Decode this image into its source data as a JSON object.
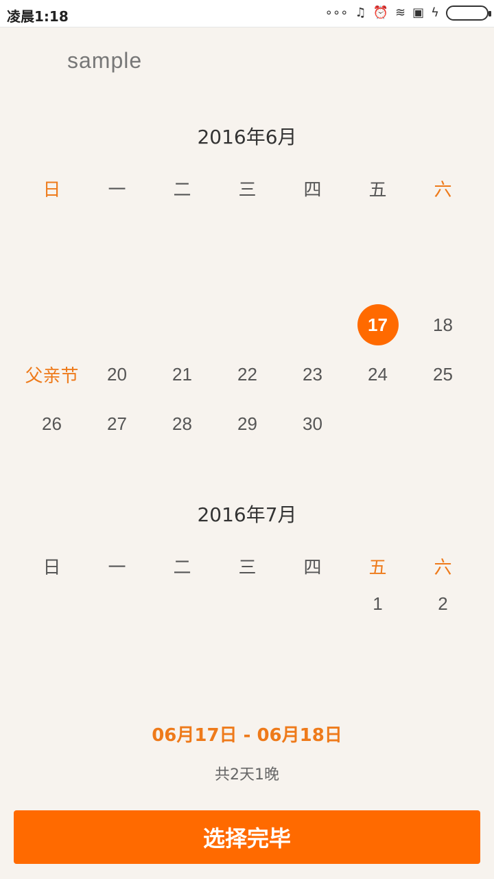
{
  "status": {
    "time": "凌晨1:18",
    "icons": [
      "signal-dots-icon",
      "headphones-icon",
      "alarm-icon",
      "wifi-icon",
      "sim-icon",
      "charging-icon",
      "battery-icon"
    ]
  },
  "app": {
    "title": "sample"
  },
  "weekdays": [
    "日",
    "一",
    "二",
    "三",
    "四",
    "五",
    "六"
  ],
  "months": [
    {
      "title": "2016年6月",
      "rows": [
        [
          "",
          "",
          "",
          "",
          "",
          "",
          ""
        ],
        [
          "",
          "",
          "",
          "",
          "",
          "",
          ""
        ],
        [
          "",
          "",
          "",
          "",
          "",
          "17",
          "18"
        ],
        [
          "父亲节",
          "20",
          "21",
          "22",
          "23",
          "24",
          "25"
        ],
        [
          "26",
          "27",
          "28",
          "29",
          "30",
          "",
          ""
        ]
      ],
      "selected": "17",
      "holiday": "父亲节"
    },
    {
      "title": "2016年7月",
      "rows": [
        [
          "",
          "",
          "",
          "",
          "",
          "1",
          "2"
        ]
      ]
    }
  ],
  "selection": {
    "range": "06月17日 - 06月18日",
    "nights": "共2天1晚"
  },
  "button": {
    "label": "选择完毕"
  },
  "colors": {
    "accent": "#ff6a00",
    "background": "#f7f3ee"
  }
}
